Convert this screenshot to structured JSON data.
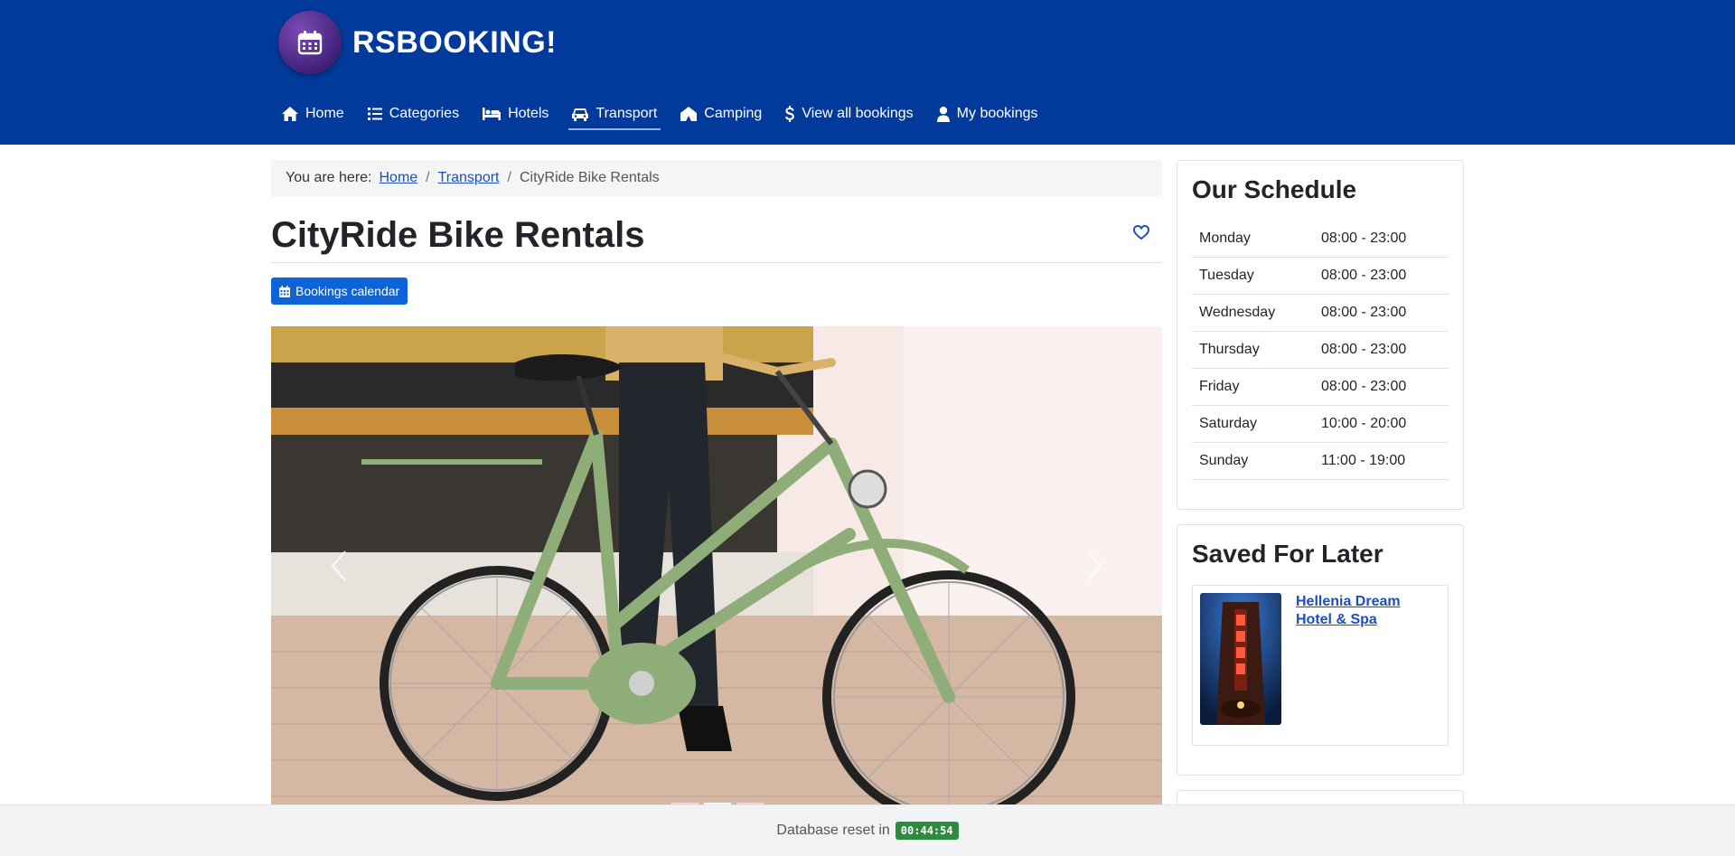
{
  "brand": {
    "name": "RSBOOKING!",
    "logo_icon": "calendar-icon"
  },
  "nav": {
    "items": [
      {
        "label": "Home",
        "icon": "home-icon",
        "active": false
      },
      {
        "label": "Categories",
        "icon": "list-icon",
        "active": false
      },
      {
        "label": "Hotels",
        "icon": "bed-icon",
        "active": false
      },
      {
        "label": "Transport",
        "icon": "car-icon",
        "active": true
      },
      {
        "label": "Camping",
        "icon": "tent-icon",
        "active": false
      },
      {
        "label": "View all bookings",
        "icon": "dollar-icon",
        "active": false
      },
      {
        "label": "My bookings",
        "icon": "user-icon",
        "active": false
      }
    ]
  },
  "breadcrumb": {
    "prefix": "You are here:",
    "items": [
      "Home",
      "Transport"
    ],
    "current": "CityRide Bike Rentals"
  },
  "page": {
    "title": "CityRide Bike Rentals",
    "favorite_icon": "heart-icon",
    "calendar_button": "Bookings calendar"
  },
  "carousel": {
    "slides": 3,
    "active_slide": 2
  },
  "schedule": {
    "title": "Our Schedule",
    "rows": [
      {
        "day": "Monday",
        "hours": "08:00 - 23:00"
      },
      {
        "day": "Tuesday",
        "hours": "08:00 - 23:00"
      },
      {
        "day": "Wednesday",
        "hours": "08:00 - 23:00"
      },
      {
        "day": "Thursday",
        "hours": "08:00 - 23:00"
      },
      {
        "day": "Friday",
        "hours": "08:00 - 23:00"
      },
      {
        "day": "Saturday",
        "hours": "10:00 - 20:00"
      },
      {
        "day": "Sunday",
        "hours": "11:00 - 19:00"
      }
    ]
  },
  "saved": {
    "title": "Saved For Later",
    "items": [
      {
        "name": "Hellenia Dream Hotel & Spa"
      }
    ]
  },
  "footer": {
    "text": "Database reset in",
    "timer": "00:44:54"
  },
  "colors": {
    "header_bg": "#023a9c",
    "button_bg": "#0d64d8",
    "link": "#1a4fbf",
    "timer_bg": "#2e8b3d"
  }
}
